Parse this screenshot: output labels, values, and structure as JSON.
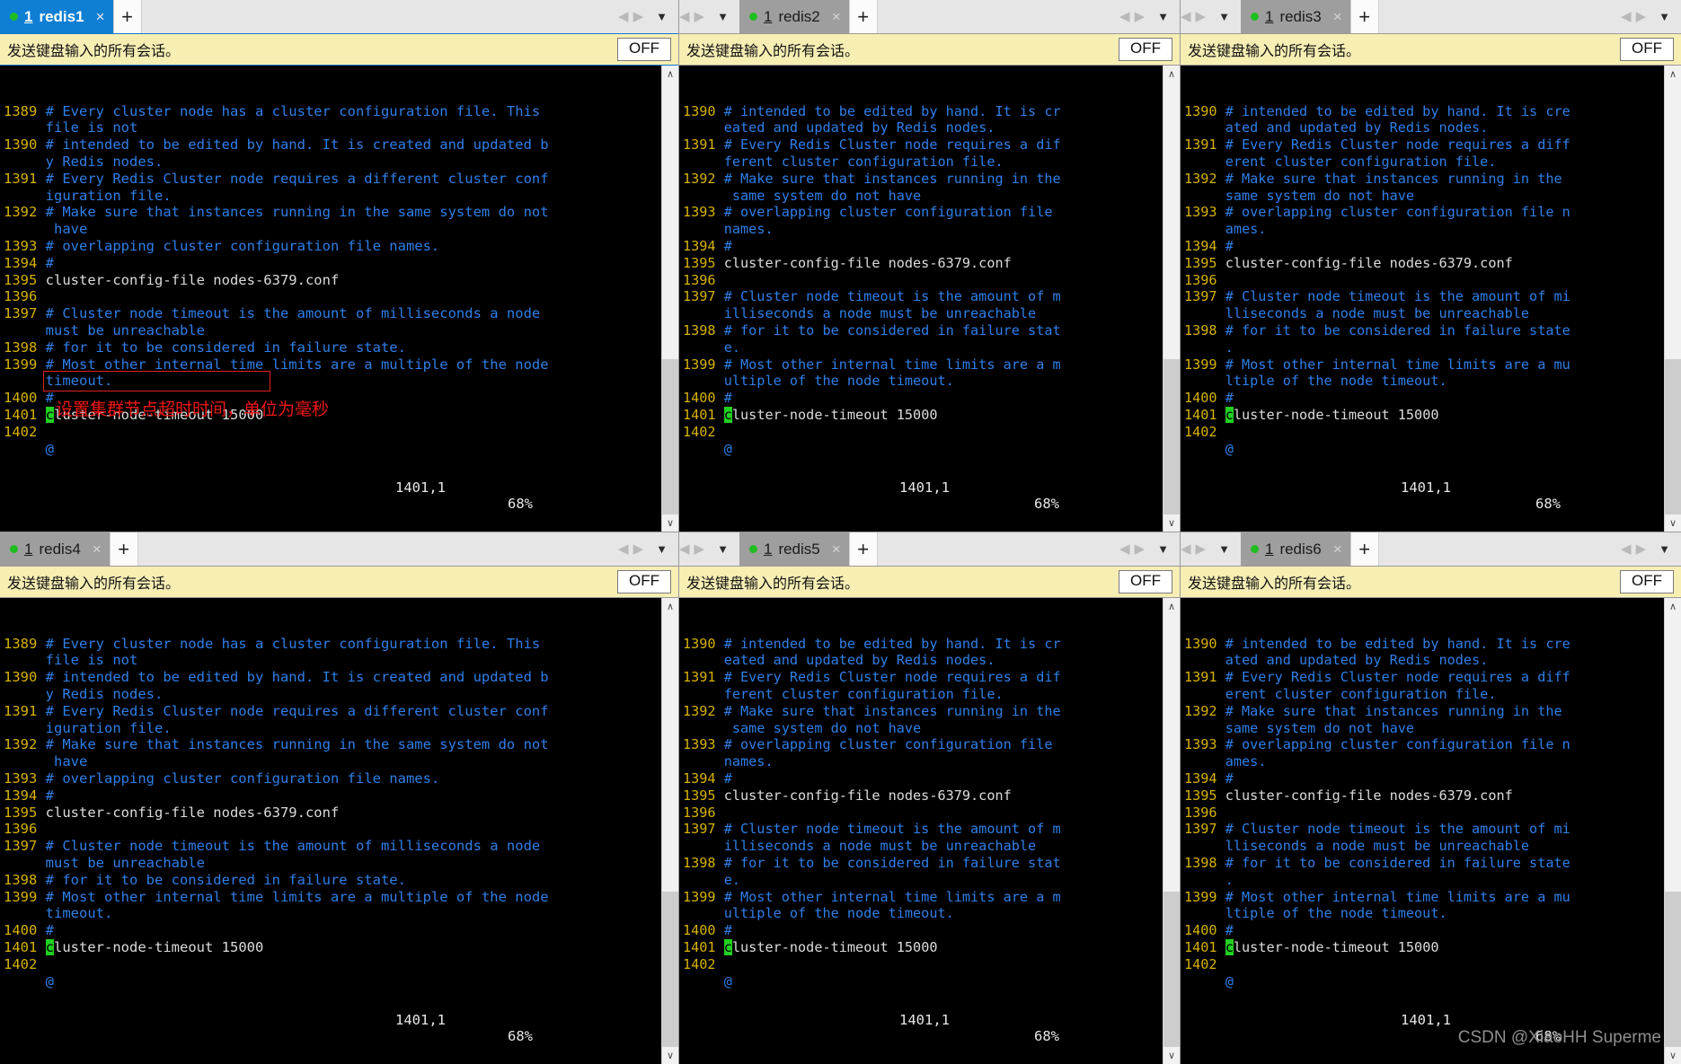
{
  "app": {
    "tab_close_glyph": "×",
    "tab_new_glyph": "+",
    "nav_prev_glyph": "◀",
    "nav_next_glyph": "▶",
    "nav_menu_glyph": "▼",
    "scroll_up_glyph": "∧",
    "scroll_down_glyph": "∨",
    "session_dot_color": "#1fbd1f",
    "active_tab_color": "#0f7fd4",
    "inactive_tab_color": "#9e9e9e",
    "sendbar_bg_color": "#f7eeb4",
    "terminal_bg_color": "#000000",
    "linenumber_color": "#d6b200",
    "comment_color": "#2f7fe8",
    "cursor_color": "#21d021",
    "annotation_color": "#ef1616"
  },
  "watermark": "CSDN @XiaoHH Superme",
  "sendbar": {
    "label": "发送键盘输入的所有会话。",
    "toggle_label": "OFF"
  },
  "annotation": {
    "text": "设置集群节点超时时间，单位为毫秒"
  },
  "status": {
    "position": "1401,1",
    "percent": "68%"
  },
  "panels": [
    {
      "id": "redis1",
      "tab": {
        "index": "1",
        "name": "redis1",
        "active": true
      },
      "wide": true,
      "lines": [
        {
          "num": "1389",
          "text": "# Every cluster node has a cluster configuration file. This",
          "kind": "comment"
        },
        {
          "num": "",
          "text": "file is not",
          "kind": "comment"
        },
        {
          "num": "1390",
          "text": "# intended to be edited by hand. It is created and updated b",
          "kind": "comment"
        },
        {
          "num": "",
          "text": "y Redis nodes.",
          "kind": "comment"
        },
        {
          "num": "1391",
          "text": "# Every Redis Cluster node requires a different cluster conf",
          "kind": "comment"
        },
        {
          "num": "",
          "text": "iguration file.",
          "kind": "comment"
        },
        {
          "num": "1392",
          "text": "# Make sure that instances running in the same system do not",
          "kind": "comment"
        },
        {
          "num": "",
          "text": " have",
          "kind": "comment"
        },
        {
          "num": "1393",
          "text": "# overlapping cluster configuration file names.",
          "kind": "comment"
        },
        {
          "num": "1394",
          "text": "#",
          "kind": "comment"
        },
        {
          "num": "1395",
          "text": "cluster-config-file nodes-6379.conf",
          "kind": "plain"
        },
        {
          "num": "1396",
          "text": "",
          "kind": "plain"
        },
        {
          "num": "1397",
          "text": "# Cluster node timeout is the amount of milliseconds a node",
          "kind": "comment"
        },
        {
          "num": "",
          "text": "must be unreachable",
          "kind": "comment"
        },
        {
          "num": "1398",
          "text": "# for it to be considered in failure state.",
          "kind": "comment"
        },
        {
          "num": "1399",
          "text": "# Most other internal time limits are a multiple of the node",
          "kind": "comment"
        },
        {
          "num": "",
          "text": "timeout.",
          "kind": "comment"
        },
        {
          "num": "1400",
          "text": "#",
          "kind": "comment"
        },
        {
          "num": "1401",
          "text": "cluster-node-timeout 15000",
          "kind": "cursorline"
        },
        {
          "num": "1402",
          "text": "",
          "kind": "plain"
        },
        {
          "num": "",
          "text": "@",
          "kind": "at"
        }
      ],
      "annotated": true
    },
    {
      "id": "redis2",
      "tab": {
        "index": "1",
        "name": "redis2",
        "active": false
      },
      "wide": false,
      "lines": [
        {
          "num": "1390",
          "text": "# intended to be edited by hand. It is cr",
          "kind": "comment"
        },
        {
          "num": "",
          "text": "eated and updated by Redis nodes.",
          "kind": "comment"
        },
        {
          "num": "1391",
          "text": "# Every Redis Cluster node requires a dif",
          "kind": "comment"
        },
        {
          "num": "",
          "text": "ferent cluster configuration file.",
          "kind": "comment"
        },
        {
          "num": "1392",
          "text": "# Make sure that instances running in the",
          "kind": "comment"
        },
        {
          "num": "",
          "text": " same system do not have",
          "kind": "comment"
        },
        {
          "num": "1393",
          "text": "# overlapping cluster configuration file",
          "kind": "comment"
        },
        {
          "num": "",
          "text": "names.",
          "kind": "comment"
        },
        {
          "num": "1394",
          "text": "#",
          "kind": "comment"
        },
        {
          "num": "1395",
          "text": "cluster-config-file nodes-6379.conf",
          "kind": "plain"
        },
        {
          "num": "1396",
          "text": "",
          "kind": "plain"
        },
        {
          "num": "1397",
          "text": "# Cluster node timeout is the amount of m",
          "kind": "comment"
        },
        {
          "num": "",
          "text": "illiseconds a node must be unreachable",
          "kind": "comment"
        },
        {
          "num": "1398",
          "text": "# for it to be considered in failure stat",
          "kind": "comment"
        },
        {
          "num": "",
          "text": "e.",
          "kind": "comment"
        },
        {
          "num": "1399",
          "text": "# Most other internal time limits are a m",
          "kind": "comment"
        },
        {
          "num": "",
          "text": "ultiple of the node timeout.",
          "kind": "comment"
        },
        {
          "num": "1400",
          "text": "#",
          "kind": "comment"
        },
        {
          "num": "1401",
          "text": "cluster-node-timeout 15000",
          "kind": "cursorline"
        },
        {
          "num": "1402",
          "text": "",
          "kind": "plain"
        },
        {
          "num": "",
          "text": "@",
          "kind": "at"
        }
      ],
      "annotated": false
    },
    {
      "id": "redis3",
      "tab": {
        "index": "1",
        "name": "redis3",
        "active": false
      },
      "wide": false,
      "lines": [
        {
          "num": "1390",
          "text": "# intended to be edited by hand. It is cre",
          "kind": "comment"
        },
        {
          "num": "",
          "text": "ated and updated by Redis nodes.",
          "kind": "comment"
        },
        {
          "num": "1391",
          "text": "# Every Redis Cluster node requires a diff",
          "kind": "comment"
        },
        {
          "num": "",
          "text": "erent cluster configuration file.",
          "kind": "comment"
        },
        {
          "num": "1392",
          "text": "# Make sure that instances running in the",
          "kind": "comment"
        },
        {
          "num": "",
          "text": "same system do not have",
          "kind": "comment"
        },
        {
          "num": "1393",
          "text": "# overlapping cluster configuration file n",
          "kind": "comment"
        },
        {
          "num": "",
          "text": "ames.",
          "kind": "comment"
        },
        {
          "num": "1394",
          "text": "#",
          "kind": "comment"
        },
        {
          "num": "1395",
          "text": "cluster-config-file nodes-6379.conf",
          "kind": "plain"
        },
        {
          "num": "1396",
          "text": "",
          "kind": "plain"
        },
        {
          "num": "1397",
          "text": "# Cluster node timeout is the amount of mi",
          "kind": "comment"
        },
        {
          "num": "",
          "text": "lliseconds a node must be unreachable",
          "kind": "comment"
        },
        {
          "num": "1398",
          "text": "# for it to be considered in failure state",
          "kind": "comment"
        },
        {
          "num": "",
          "text": ".",
          "kind": "comment"
        },
        {
          "num": "1399",
          "text": "# Most other internal time limits are a mu",
          "kind": "comment"
        },
        {
          "num": "",
          "text": "ltiple of the node timeout.",
          "kind": "comment"
        },
        {
          "num": "1400",
          "text": "#",
          "kind": "comment"
        },
        {
          "num": "1401",
          "text": "cluster-node-timeout 15000",
          "kind": "cursorline"
        },
        {
          "num": "1402",
          "text": "",
          "kind": "plain"
        },
        {
          "num": "",
          "text": "@",
          "kind": "at"
        }
      ],
      "annotated": false
    },
    {
      "id": "redis4",
      "tab": {
        "index": "1",
        "name": "redis4",
        "active": false
      },
      "wide": true,
      "lines": [
        {
          "num": "1389",
          "text": "# Every cluster node has a cluster configuration file. This",
          "kind": "comment"
        },
        {
          "num": "",
          "text": "file is not",
          "kind": "comment"
        },
        {
          "num": "1390",
          "text": "# intended to be edited by hand. It is created and updated b",
          "kind": "comment"
        },
        {
          "num": "",
          "text": "y Redis nodes.",
          "kind": "comment"
        },
        {
          "num": "1391",
          "text": "# Every Redis Cluster node requires a different cluster conf",
          "kind": "comment"
        },
        {
          "num": "",
          "text": "iguration file.",
          "kind": "comment"
        },
        {
          "num": "1392",
          "text": "# Make sure that instances running in the same system do not",
          "kind": "comment"
        },
        {
          "num": "",
          "text": " have",
          "kind": "comment"
        },
        {
          "num": "1393",
          "text": "# overlapping cluster configuration file names.",
          "kind": "comment"
        },
        {
          "num": "1394",
          "text": "#",
          "kind": "comment"
        },
        {
          "num": "1395",
          "text": "cluster-config-file nodes-6379.conf",
          "kind": "plain"
        },
        {
          "num": "1396",
          "text": "",
          "kind": "plain"
        },
        {
          "num": "1397",
          "text": "# Cluster node timeout is the amount of milliseconds a node",
          "kind": "comment"
        },
        {
          "num": "",
          "text": "must be unreachable",
          "kind": "comment"
        },
        {
          "num": "1398",
          "text": "# for it to be considered in failure state.",
          "kind": "comment"
        },
        {
          "num": "1399",
          "text": "# Most other internal time limits are a multiple of the node",
          "kind": "comment"
        },
        {
          "num": "",
          "text": "timeout.",
          "kind": "comment"
        },
        {
          "num": "1400",
          "text": "#",
          "kind": "comment"
        },
        {
          "num": "1401",
          "text": "cluster-node-timeout 15000",
          "kind": "cursorline"
        },
        {
          "num": "1402",
          "text": "",
          "kind": "plain"
        },
        {
          "num": "",
          "text": "@",
          "kind": "at"
        }
      ],
      "annotated": false
    },
    {
      "id": "redis5",
      "tab": {
        "index": "1",
        "name": "redis5",
        "active": false
      },
      "wide": false,
      "lines": [
        {
          "num": "1390",
          "text": "# intended to be edited by hand. It is cr",
          "kind": "comment"
        },
        {
          "num": "",
          "text": "eated and updated by Redis nodes.",
          "kind": "comment"
        },
        {
          "num": "1391",
          "text": "# Every Redis Cluster node requires a dif",
          "kind": "comment"
        },
        {
          "num": "",
          "text": "ferent cluster configuration file.",
          "kind": "comment"
        },
        {
          "num": "1392",
          "text": "# Make sure that instances running in the",
          "kind": "comment"
        },
        {
          "num": "",
          "text": " same system do not have",
          "kind": "comment"
        },
        {
          "num": "1393",
          "text": "# overlapping cluster configuration file",
          "kind": "comment"
        },
        {
          "num": "",
          "text": "names.",
          "kind": "comment"
        },
        {
          "num": "1394",
          "text": "#",
          "kind": "comment"
        },
        {
          "num": "1395",
          "text": "cluster-config-file nodes-6379.conf",
          "kind": "plain"
        },
        {
          "num": "1396",
          "text": "",
          "kind": "plain"
        },
        {
          "num": "1397",
          "text": "# Cluster node timeout is the amount of m",
          "kind": "comment"
        },
        {
          "num": "",
          "text": "illiseconds a node must be unreachable",
          "kind": "comment"
        },
        {
          "num": "1398",
          "text": "# for it to be considered in failure stat",
          "kind": "comment"
        },
        {
          "num": "",
          "text": "e.",
          "kind": "comment"
        },
        {
          "num": "1399",
          "text": "# Most other internal time limits are a m",
          "kind": "comment"
        },
        {
          "num": "",
          "text": "ultiple of the node timeout.",
          "kind": "comment"
        },
        {
          "num": "1400",
          "text": "#",
          "kind": "comment"
        },
        {
          "num": "1401",
          "text": "cluster-node-timeout 15000",
          "kind": "cursorline"
        },
        {
          "num": "1402",
          "text": "",
          "kind": "plain"
        },
        {
          "num": "",
          "text": "@",
          "kind": "at"
        }
      ],
      "annotated": false
    },
    {
      "id": "redis6",
      "tab": {
        "index": "1",
        "name": "redis6",
        "active": false
      },
      "wide": false,
      "lines": [
        {
          "num": "1390",
          "text": "# intended to be edited by hand. It is cre",
          "kind": "comment"
        },
        {
          "num": "",
          "text": "ated and updated by Redis nodes.",
          "kind": "comment"
        },
        {
          "num": "1391",
          "text": "# Every Redis Cluster node requires a diff",
          "kind": "comment"
        },
        {
          "num": "",
          "text": "erent cluster configuration file.",
          "kind": "comment"
        },
        {
          "num": "1392",
          "text": "# Make sure that instances running in the",
          "kind": "comment"
        },
        {
          "num": "",
          "text": "same system do not have",
          "kind": "comment"
        },
        {
          "num": "1393",
          "text": "# overlapping cluster configuration file n",
          "kind": "comment"
        },
        {
          "num": "",
          "text": "ames.",
          "kind": "comment"
        },
        {
          "num": "1394",
          "text": "#",
          "kind": "comment"
        },
        {
          "num": "1395",
          "text": "cluster-config-file nodes-6379.conf",
          "kind": "plain"
        },
        {
          "num": "1396",
          "text": "",
          "kind": "plain"
        },
        {
          "num": "1397",
          "text": "# Cluster node timeout is the amount of mi",
          "kind": "comment"
        },
        {
          "num": "",
          "text": "lliseconds a node must be unreachable",
          "kind": "comment"
        },
        {
          "num": "1398",
          "text": "# for it to be considered in failure state",
          "kind": "comment"
        },
        {
          "num": "",
          "text": ".",
          "kind": "comment"
        },
        {
          "num": "1399",
          "text": "# Most other internal time limits are a mu",
          "kind": "comment"
        },
        {
          "num": "",
          "text": "ltiple of the node timeout.",
          "kind": "comment"
        },
        {
          "num": "1400",
          "text": "#",
          "kind": "comment"
        },
        {
          "num": "1401",
          "text": "cluster-node-timeout 15000",
          "kind": "cursorline"
        },
        {
          "num": "1402",
          "text": "",
          "kind": "plain"
        },
        {
          "num": "",
          "text": "@",
          "kind": "at"
        }
      ],
      "annotated": false
    }
  ]
}
